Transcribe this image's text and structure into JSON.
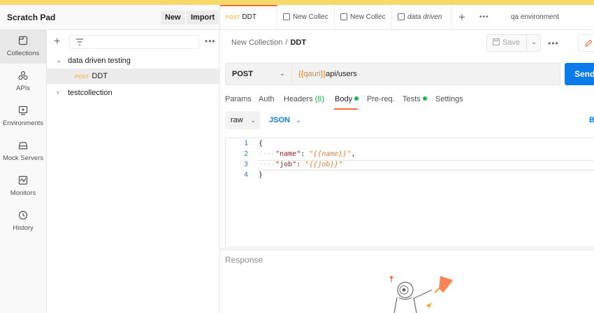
{
  "colors": {
    "accent": "#ff6c37",
    "primary": "#097bed",
    "method_post": "#f5a623",
    "success": "#0cbb52",
    "banner": "#f6d96b"
  },
  "workspace": {
    "title": "Scratch Pad",
    "new_label": "New",
    "import_label": "Import"
  },
  "nav": [
    {
      "label": "Collections",
      "icon": "collections-icon"
    },
    {
      "label": "APIs",
      "icon": "apis-icon"
    },
    {
      "label": "Environments",
      "icon": "environments-icon"
    },
    {
      "label": "Mock Servers",
      "icon": "mock-servers-icon"
    },
    {
      "label": "Monitors",
      "icon": "monitors-icon"
    },
    {
      "label": "History",
      "icon": "history-icon"
    }
  ],
  "sidebar": {
    "tree": [
      {
        "label": "data driven testing",
        "expanded": true
      },
      {
        "method": "POST",
        "label": "DDT",
        "selected": true
      },
      {
        "label": "testcollection",
        "expanded": false
      }
    ]
  },
  "tabs": [
    {
      "method": "POST",
      "label": "DDT"
    },
    {
      "label": "New Collec"
    },
    {
      "label": "New Collec"
    },
    {
      "label": "data driven"
    }
  ],
  "environment": "qa environment",
  "breadcrumb": {
    "collection": "New Collection",
    "separator": "/",
    "request": "DDT"
  },
  "save_label": "Save",
  "request": {
    "method": "POST",
    "url_variable": "{{qauri}}",
    "url_path": "api/users",
    "send_label": "Send"
  },
  "req_tabs": {
    "params": "Params",
    "auth": "Auth",
    "headers": "Headers",
    "headers_count": "(8)",
    "body": "Body",
    "prereq": "Pre-req.",
    "tests": "Tests",
    "settings": "Settings"
  },
  "body": {
    "mode": "raw",
    "language": "JSON",
    "beautify": "B",
    "lines": [
      {
        "n": "1",
        "open": "{"
      },
      {
        "n": "2",
        "key": "\"name\"",
        "colon": ": ",
        "q1": "\"",
        "value": "{{name}}",
        "q2": "\"",
        "tail": ","
      },
      {
        "n": "3",
        "key": "\"job\"",
        "colon": ": ",
        "q1": "\"",
        "value": "{{job}}",
        "q2": "\"",
        "tail": ""
      },
      {
        "n": "4",
        "close": "}"
      }
    ]
  },
  "response_label": "Response"
}
